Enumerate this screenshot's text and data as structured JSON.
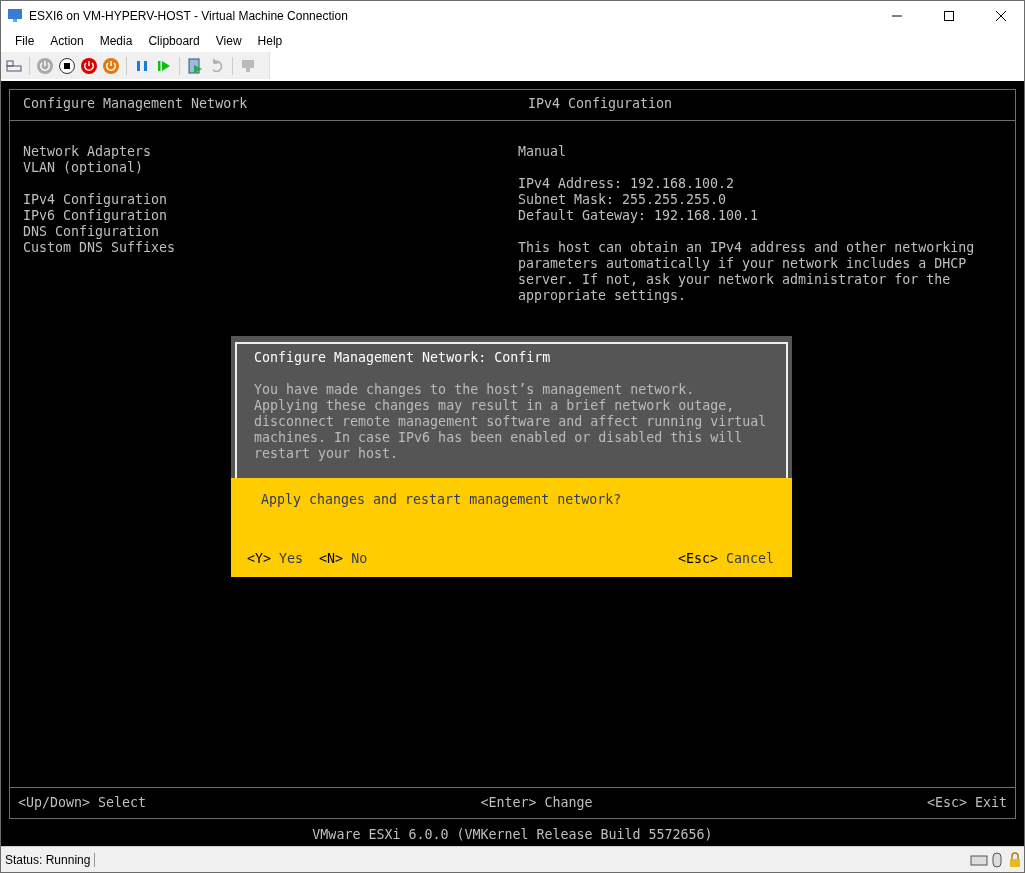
{
  "window": {
    "title": "ESXI6 on VM-HYPERV-HOST - Virtual Machine Connection"
  },
  "menu": [
    "File",
    "Action",
    "Media",
    "Clipboard",
    "View",
    "Help"
  ],
  "console": {
    "left_title": "Configure Management Network",
    "right_title": "IPv4 Configuration",
    "menu_sections": [
      [
        "Network Adapters",
        "VLAN (optional)"
      ],
      [
        "IPv4 Configuration",
        "IPv6 Configuration",
        "DNS Configuration",
        "Custom DNS Suffixes"
      ]
    ],
    "mode": "Manual",
    "settings": [
      "IPv4 Address: 192.168.100.2",
      "Subnet Mask: 255.255.255.0",
      "Default Gateway: 192.168.100.1"
    ],
    "description": [
      "This host can obtain an IPv4 address and other networking",
      "parameters automatically if your network includes a DHCP",
      "server. If not, ask your network administrator for the",
      "appropriate settings."
    ],
    "footer": [
      {
        "key": "<Up/Down>",
        "label": "Select"
      },
      {
        "key": "<Enter>",
        "label": "Change"
      },
      {
        "key": "<Esc>",
        "label": "Exit"
      }
    ],
    "version": "VMware ESXi 6.0.0 (VMKernel Release Build 5572656)"
  },
  "dialog": {
    "title": "Configure Management Network: Confirm",
    "message": [
      "You have made changes to the host’s management network.",
      "Applying these changes may result in a brief network outage,",
      "disconnect remote management software and affect running virtual",
      "machines. In case IPv6 has been enabled or disabled this will",
      "restart your host."
    ],
    "question": "Apply changes and restart management network?",
    "actions": [
      {
        "key": "<Y>",
        "label": "Yes"
      },
      {
        "key": "<N>",
        "label": "No"
      },
      {
        "key": "<Esc>",
        "label": "Cancel"
      }
    ]
  },
  "status_bar": {
    "status": "Status: Running"
  }
}
